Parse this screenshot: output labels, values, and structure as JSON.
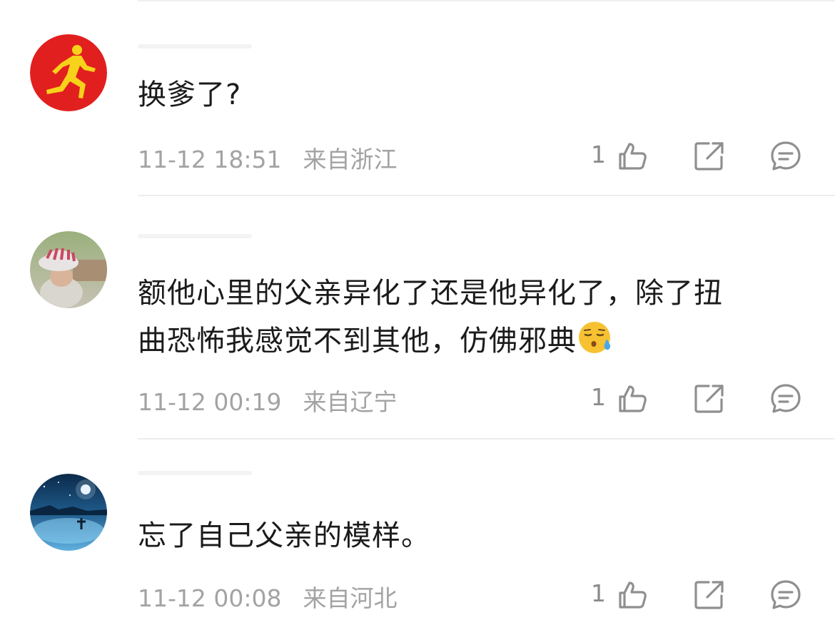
{
  "comments": [
    {
      "text": "换爹了?",
      "time": "11-12 18:51",
      "location": "来自浙江",
      "likes": "1",
      "avatar": "runner-avatar"
    },
    {
      "text_line1": "额他心里的父亲异化了还是他异化了，除了扭",
      "text_line2": "曲恐怖我感觉不到其他，仿佛邪典",
      "emoji": "sad-sweat-emoji",
      "time": "11-12 00:19",
      "location": "来自辽宁",
      "likes": "1",
      "avatar": "hat-person-avatar"
    },
    {
      "text": "忘了自己父亲的模样。",
      "time": "11-12 00:08",
      "location": "来自河北",
      "likes": "1",
      "avatar": "night-sea-avatar"
    }
  ],
  "icons": {
    "like": "thumbs-up-icon",
    "share": "share-icon",
    "reply": "comment-icon"
  },
  "colors": {
    "meta_text": "#a3a3a3",
    "icon_stroke": "#8f8f8f",
    "divider": "#ededed"
  }
}
